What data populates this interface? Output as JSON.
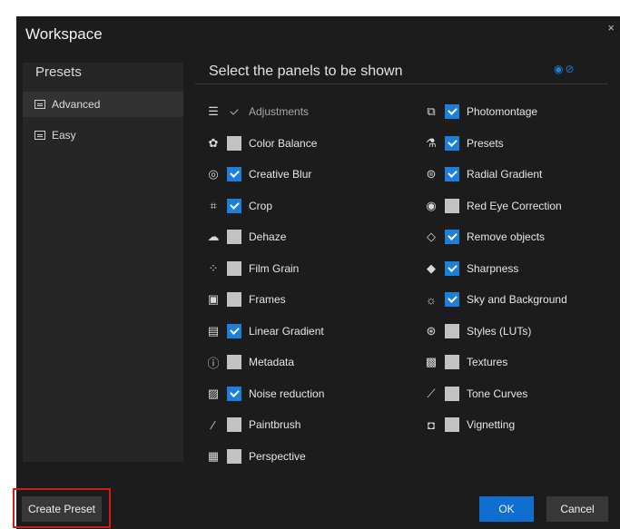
{
  "dialog": {
    "title": "Workspace",
    "close_glyph": "×"
  },
  "presets": {
    "heading": "Presets",
    "items": [
      {
        "label": "Advanced",
        "selected": true
      },
      {
        "label": "Easy",
        "selected": false
      }
    ]
  },
  "panels": {
    "heading": "Select the panels to be shown",
    "header_icons": [
      "eye-icon",
      "eye-off-icon"
    ],
    "left": [
      {
        "label": "Adjustments",
        "icon": "sliders-icon",
        "state": "fixed"
      },
      {
        "label": "Color Balance",
        "icon": "palette-icon",
        "state": "off"
      },
      {
        "label": "Creative Blur",
        "icon": "blur-target-icon",
        "state": "on"
      },
      {
        "label": "Crop",
        "icon": "crop-icon",
        "state": "on"
      },
      {
        "label": "Dehaze",
        "icon": "cloud-icon",
        "state": "off"
      },
      {
        "label": "Film Grain",
        "icon": "grain-icon",
        "state": "off"
      },
      {
        "label": "Frames",
        "icon": "frame-icon",
        "state": "off"
      },
      {
        "label": "Linear Gradient",
        "icon": "gradient-icon",
        "state": "on"
      },
      {
        "label": "Metadata",
        "icon": "info-icon",
        "state": "off"
      },
      {
        "label": "Noise reduction",
        "icon": "noise-icon",
        "state": "on"
      },
      {
        "label": "Paintbrush",
        "icon": "brush-icon",
        "state": "off"
      },
      {
        "label": "Perspective",
        "icon": "perspective-icon",
        "state": "off"
      }
    ],
    "right": [
      {
        "label": "Photomontage",
        "icon": "photomontage-icon",
        "state": "on"
      },
      {
        "label": "Presets",
        "icon": "flask-icon",
        "state": "on"
      },
      {
        "label": "Radial Gradient",
        "icon": "radial-icon",
        "state": "on"
      },
      {
        "label": "Red Eye Correction",
        "icon": "eye-icon",
        "state": "off"
      },
      {
        "label": "Remove objects",
        "icon": "eraser-icon",
        "state": "on"
      },
      {
        "label": "Sharpness",
        "icon": "diamond-icon",
        "state": "on"
      },
      {
        "label": "Sky and Background",
        "icon": "sky-icon",
        "state": "on"
      },
      {
        "label": "Styles (LUTs)",
        "icon": "styles-icon",
        "state": "off"
      },
      {
        "label": "Textures",
        "icon": "texture-icon",
        "state": "off"
      },
      {
        "label": "Tone Curves",
        "icon": "curve-icon",
        "state": "off"
      },
      {
        "label": "Vignetting",
        "icon": "vignette-icon",
        "state": "off"
      }
    ]
  },
  "buttons": {
    "create": "Create Preset",
    "ok": "OK",
    "cancel": "Cancel"
  },
  "colors": {
    "accent": "#1e7fd8",
    "highlight": "#d21b1b",
    "background": "#1c1c1c"
  }
}
